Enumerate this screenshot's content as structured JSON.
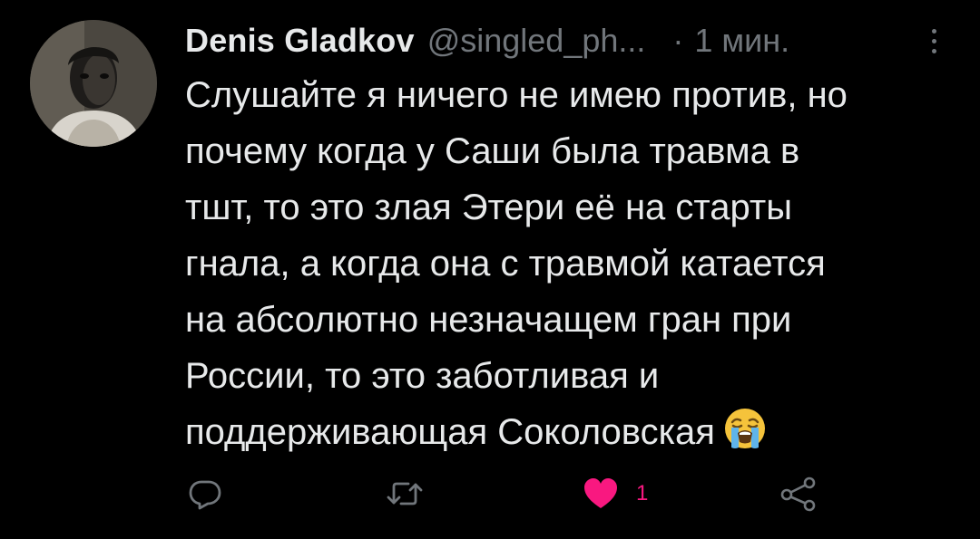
{
  "tweet": {
    "display_name": "Denis Gladkov",
    "handle": "@singled_ph...",
    "separator": "·",
    "time": "1 мин.",
    "text_lines": [
      "Слушайте я ничего не имею против, но",
      "почему когда у Саши была травма в",
      "тшт, то это злая Этери её на старты",
      "гнала, а когда она с травмой катается",
      "на абсолютно незначащем гран при",
      "России, то это заботливая и",
      "поддерживающая Соколовская"
    ],
    "emoji": "loudly-crying-face-emoji"
  },
  "actions": {
    "reply_icon": "reply-icon",
    "retweet_icon": "retweet-icon",
    "like_icon": "heart-icon",
    "like_count": "1",
    "share_icon": "share-icon"
  },
  "colors": {
    "background": "#000000",
    "text": "#e7e9ea",
    "secondary": "#71767b",
    "like": "#f91880"
  }
}
